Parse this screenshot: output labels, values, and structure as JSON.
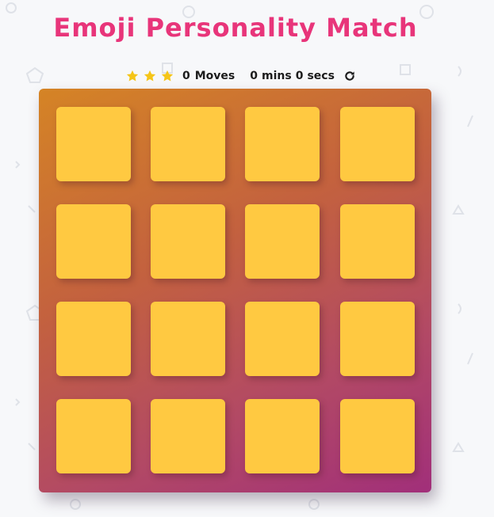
{
  "title": "Emoji Personality Match",
  "score": {
    "stars": [
      "star-icon",
      "star-icon",
      "star-icon"
    ],
    "star_color": "#f5c518",
    "moves_count": "0",
    "moves_label": "Moves",
    "mins_count": "0",
    "mins_label": "mins",
    "secs_count": "0",
    "secs_label": "secs",
    "restart_icon": "restart-icon"
  },
  "deck": {
    "rows": 4,
    "columns": 4,
    "card_color": "#ffc941",
    "gradient": [
      "#d58425",
      "#a12f7a"
    ]
  },
  "colors": {
    "title": "#e8357a",
    "background": "#f7f8fa",
    "text": "#1c1c1c"
  }
}
